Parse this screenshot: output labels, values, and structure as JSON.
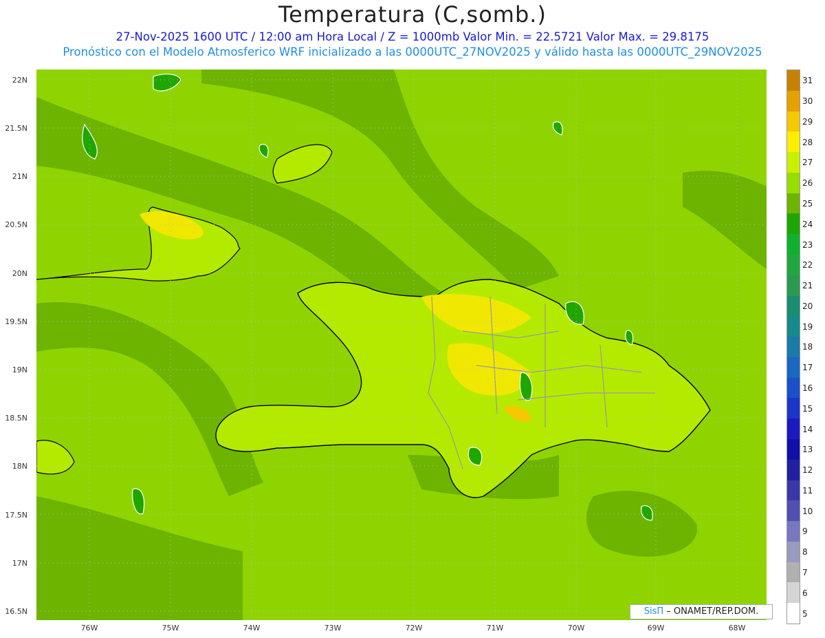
{
  "header": {
    "title": "Temperatura (C,somb.)",
    "line1": "27-Nov-2025 1600 UTC / 12:00 am Hora Local / Z = 1000mb  Valor Min. = 22.5721  Valor Max. = 29.8175",
    "line2": "Pronóstico con el Modelo Atmosferico WRF inicializado a las 0000UTC_27NOV2025 y válido hasta las  0000UTC_29NOV2025"
  },
  "axes": {
    "lat_labels": [
      "22N",
      "21.5N",
      "21N",
      "20.5N",
      "20N",
      "19.5N",
      "19N",
      "18.5N",
      "18N",
      "17.5N",
      "17N",
      "16.5N"
    ],
    "lon_labels": [
      "76W",
      "75W",
      "74W",
      "73W",
      "72W",
      "71W",
      "70W",
      "69W",
      "68W"
    ]
  },
  "colorbar": {
    "labels": [
      "31",
      "30",
      "29",
      "28",
      "27",
      "26",
      "25",
      "24",
      "23",
      "22",
      "21",
      "20",
      "19",
      "18",
      "17",
      "16",
      "15",
      "14",
      "13",
      "12",
      "11",
      "10",
      "9",
      "8",
      "7",
      "6",
      "5"
    ],
    "colors": [
      "#c88200",
      "#e6a000",
      "#f5c800",
      "#ffee00",
      "#c8f000",
      "#98dc00",
      "#6cb400",
      "#1fa600",
      "#10b030",
      "#20a840",
      "#2a9a50",
      "#1a8c70",
      "#168a8a",
      "#1a7aa8",
      "#1a68c0",
      "#1a50c8",
      "#1a36c8",
      "#1a1ac0",
      "#1010a8",
      "#2020a0",
      "#3838a8",
      "#5050b0",
      "#7878c0",
      "#9a9ac0",
      "#b0b0b0",
      "#d4d4d4",
      "#ffffff"
    ]
  },
  "credit": {
    "brand": "SisΠ",
    "text": " – ONAMET/REP.DOM."
  },
  "map_colors": {
    "base": "#8fd400",
    "dark": "#6cb400",
    "light": "#b4ea00",
    "warm": "#f0e800",
    "hot": "#f5c800",
    "cool": "#1fa600",
    "coast": "#000000",
    "borders": "#9a9a9a"
  }
}
